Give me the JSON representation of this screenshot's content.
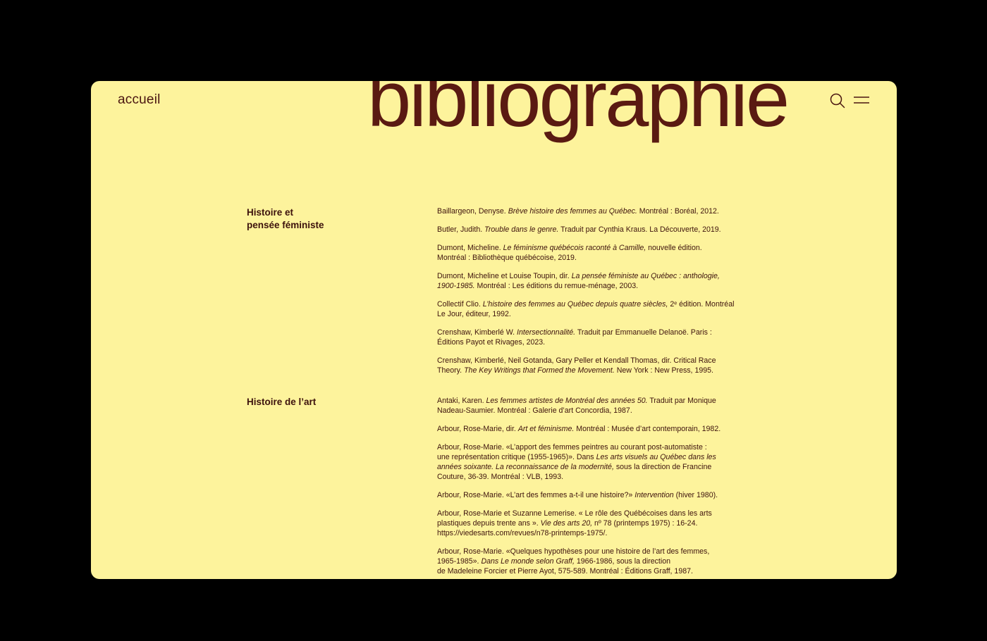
{
  "header": {
    "home_link": "accueil",
    "title": "bibliographie",
    "search_icon": "search-icon",
    "menu_icon": "menu-icon"
  },
  "colors": {
    "page_background": "#000000",
    "card_background": "#fdf39c",
    "title_color": "#5a1a12",
    "text_color": "#3d120c"
  },
  "sections": [
    {
      "title_lines": [
        "Histoire et",
        "pensée féministe"
      ],
      "entries": [
        [
          [
            {
              "t": "Baillargeon, Denyse. "
            },
            {
              "t": "Brève histoire des femmes au Québec.",
              "i": true
            },
            {
              "t": " Montréal : Boréal, 2012."
            }
          ]
        ],
        [
          [
            {
              "t": "Butler, Judith. "
            },
            {
              "t": "Trouble dans le genre.",
              "i": true
            },
            {
              "t": " Traduit par Cynthia Kraus. La Découverte, 2019."
            }
          ]
        ],
        [
          [
            {
              "t": "Dumont, Micheline. "
            },
            {
              "t": "Le féminisme québécois raconté à Camille,",
              "i": true
            },
            {
              "t": " nouvelle édition."
            }
          ],
          [
            {
              "t": "Montréal : Bibliothèque québécoise, 2019."
            }
          ]
        ],
        [
          [
            {
              "t": "Dumont, Micheline et Louise Toupin, dir. "
            },
            {
              "t": "La pensée féministe au Québec : anthologie,",
              "i": true
            }
          ],
          [
            {
              "t": "1900-1985.",
              "i": true
            },
            {
              "t": " Montréal : Les éditions du remue-ménage, 2003."
            }
          ]
        ],
        [
          [
            {
              "t": "Collectif Clio. "
            },
            {
              "t": "L’histoire des femmes au Québec depuis quatre siècles,",
              "i": true
            },
            {
              "t": " 2ᵉ édition. Montréal"
            }
          ],
          [
            {
              "t": "Le Jour, éditeur, 1992."
            }
          ]
        ],
        [
          [
            {
              "t": "Crenshaw, Kimberlé W. "
            },
            {
              "t": "Intersectionnalité.",
              "i": true
            },
            {
              "t": " Traduit par Emmanuelle Delanoë. Paris :"
            }
          ],
          [
            {
              "t": "Éditions Payot et Rivages, 2023."
            }
          ]
        ],
        [
          [
            {
              "t": "Crenshaw, Kimberlé, Neil Gotanda, Gary Peller et Kendall Thomas, dir. Critical Race"
            }
          ],
          [
            {
              "t": "Theory. "
            },
            {
              "t": "The Key Writings that Formed the Movement.",
              "i": true
            },
            {
              "t": " New York : New Press, 1995."
            }
          ]
        ]
      ]
    },
    {
      "title_lines": [
        "Histoire de l’art"
      ],
      "entries": [
        [
          [
            {
              "t": "Antaki, Karen. "
            },
            {
              "t": "Les femmes artistes de Montréal des années 50.",
              "i": true
            },
            {
              "t": " Traduit par Monique"
            }
          ],
          [
            {
              "t": "Nadeau-Saumier. Montréal : Galerie d’art Concordia, 1987."
            }
          ]
        ],
        [
          [
            {
              "t": "Arbour, Rose-Marie, dir. "
            },
            {
              "t": "Art et féminisme.",
              "i": true
            },
            {
              "t": " Montréal : Musée d’art contemporain, 1982."
            }
          ]
        ],
        [
          [
            {
              "t": "Arbour, Rose-Marie. «L’apport des femmes peintres au courant post-automatiste :"
            }
          ],
          [
            {
              "t": "une représentation critique (1955-1965)». Dans "
            },
            {
              "t": "Les arts visuels au Québec dans les",
              "i": true
            }
          ],
          [
            {
              "t": "années soixante. La reconnaissance de la modernité,",
              "i": true
            },
            {
              "t": " sous la direction de Francine"
            }
          ],
          [
            {
              "t": "Couture, 36-39. Montréal : VLB, 1993."
            }
          ]
        ],
        [
          [
            {
              "t": "Arbour, Rose-Marie. «L’art des femmes a-t-il une histoire?» "
            },
            {
              "t": "Intervention",
              "i": true
            },
            {
              "t": " (hiver 1980)."
            }
          ]
        ],
        [
          [
            {
              "t": "Arbour, Rose-Marie et Suzanne Lemerise. « Le rôle des Québécoises dans les arts"
            }
          ],
          [
            {
              "t": "plastiques depuis trente ans ». "
            },
            {
              "t": "Vie des arts 20,",
              "i": true
            },
            {
              "t": " nº 78 (printemps 1975) : 16-24."
            }
          ],
          [
            {
              "t": "https://viedesarts.com/revues/n78-printemps-1975/."
            }
          ]
        ],
        [
          [
            {
              "t": "Arbour, Rose-Marie. «Quelques hypothèses pour une histoire de l’art des femmes,"
            }
          ],
          [
            {
              "t": "1965-1985». "
            },
            {
              "t": "Dans Le monde selon Graff,",
              "i": true
            },
            {
              "t": " 1966-1986, sous la direction"
            }
          ],
          [
            {
              "t": "de Madeleine Forcier et Pierre Ayot, 575-589. Montréal : Éditions Graff, 1987."
            }
          ]
        ]
      ]
    }
  ]
}
